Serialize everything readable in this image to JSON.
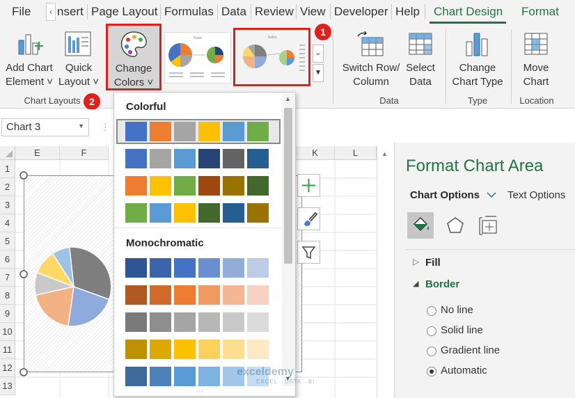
{
  "menu": {
    "file": "File",
    "insert": "nsert",
    "page_layout": "Page Layout",
    "formulas": "Formulas",
    "data": "Data",
    "review": "Review",
    "view": "View",
    "developer": "Developer",
    "help": "Help",
    "chart_design": "Chart Design",
    "format": "Format"
  },
  "ribbon": {
    "add_chart_element": [
      "Add Chart",
      "Element ˅"
    ],
    "quick_layout": [
      "Quick",
      "Layout ˅"
    ],
    "change_colors": [
      "Change",
      "Colors ˅"
    ],
    "group_chart_layouts": "Chart Layouts",
    "switch_row_column": [
      "Switch Row/",
      "Column"
    ],
    "select_data": [
      "Select",
      "Data"
    ],
    "group_data": "Data",
    "change_chart_type": [
      "Change",
      "Chart Type"
    ],
    "group_type": "Type",
    "move_chart": [
      "Move",
      "Chart"
    ],
    "group_location": "Location"
  },
  "badges": {
    "one": "1",
    "two": "2"
  },
  "name_box": {
    "value": "Chart 3"
  },
  "sheet": {
    "columns": [
      "E",
      "F",
      "K",
      "L"
    ],
    "rows": [
      "1",
      "2",
      "3",
      "4",
      "5",
      "6",
      "7",
      "8",
      "9",
      "10",
      "11",
      "12",
      "13"
    ]
  },
  "dropdown": {
    "colorful_heading": "Colorful",
    "monochromatic_heading": "Monochromatic",
    "colorful_rows": [
      [
        "#4472c4",
        "#ed7d31",
        "#a5a5a5",
        "#ffc000",
        "#5b9bd5",
        "#70ad47"
      ],
      [
        "#4472c4",
        "#a5a5a5",
        "#5b9bd5",
        "#264478",
        "#636363",
        "#255e91"
      ],
      [
        "#ed7d31",
        "#ffc000",
        "#70ad47",
        "#9e480e",
        "#997300",
        "#43682b"
      ],
      [
        "#70ad47",
        "#5b9bd5",
        "#ffc000",
        "#43682b",
        "#255e91",
        "#997300"
      ]
    ],
    "mono_rows": [
      [
        "#2f5597",
        "#3a64ab",
        "#4472c4",
        "#6a8fd0",
        "#93add9",
        "#bccbe6"
      ],
      [
        "#b05a21",
        "#d0692a",
        "#ed7d31",
        "#f09a62",
        "#f4b693",
        "#f8d2c0"
      ],
      [
        "#7a7a7a",
        "#8e8e8e",
        "#a5a5a5",
        "#b7b7b7",
        "#c9c9c9",
        "#dbdbdb"
      ],
      [
        "#bf9000",
        "#dfa800",
        "#ffc000",
        "#ffd05a",
        "#ffdd91",
        "#ffe9c4"
      ],
      [
        "#3d6a98",
        "#4a82b9",
        "#5b9bd5",
        "#7eb2e0",
        "#a2c7ea",
        "#c5dcf3"
      ]
    ]
  },
  "pane": {
    "title": "Format Chart Area",
    "chart_options": "Chart Options",
    "text_options": "Text Options",
    "fill": "Fill",
    "border": "Border",
    "no_line": "No line",
    "solid_line": "Solid line",
    "gradient_line": "Gradient line",
    "automatic": "Automatic"
  },
  "watermark": {
    "brand": "exceldemy",
    "tagline": "EXCEL · DATA · BI"
  },
  "colors": {
    "accent": "#217346",
    "highlight": "#e0201b"
  }
}
